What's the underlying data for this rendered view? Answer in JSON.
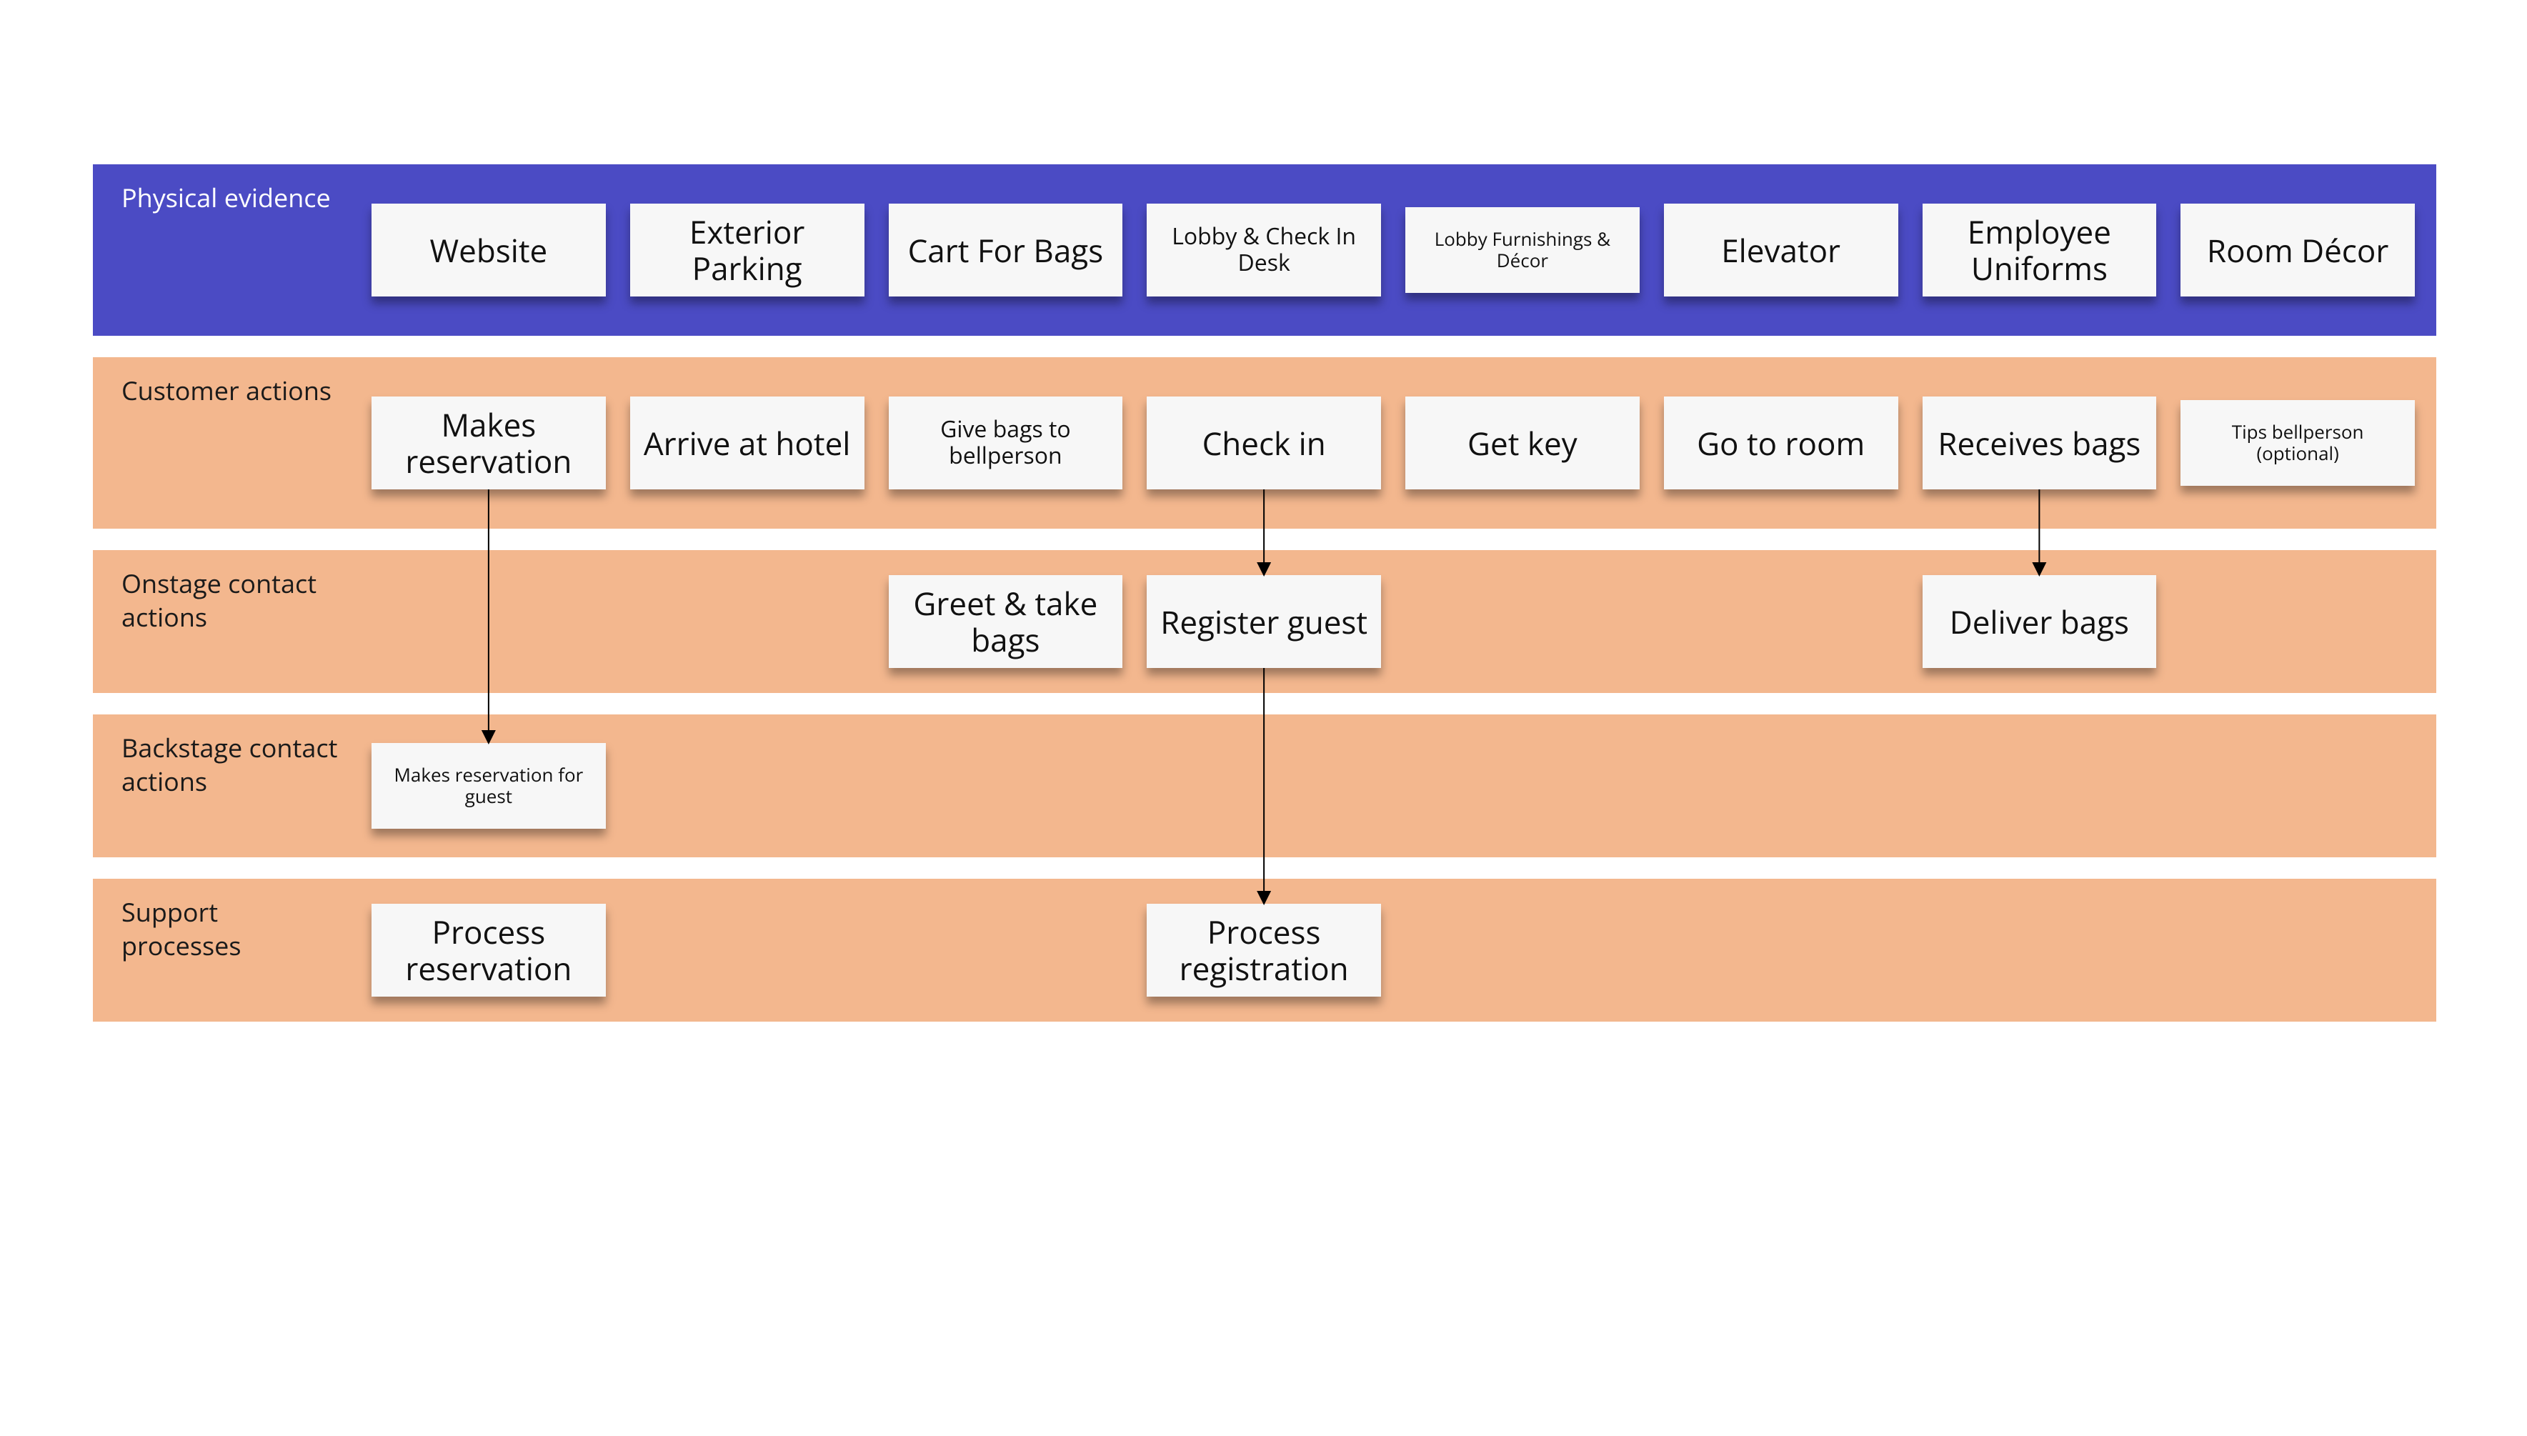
{
  "lanes": [
    {
      "id": "physical-evidence",
      "label": "Physical evidence",
      "bg": "purple",
      "labelLight": true,
      "cards": [
        {
          "text": "Website"
        },
        {
          "text": "Exterior Parking"
        },
        {
          "text": "Cart For Bags"
        },
        {
          "text": "Lobby & Check In Desk",
          "size": "sm"
        },
        {
          "text": "Lobby Furnishings & Décor",
          "size": "xs"
        },
        {
          "text": "Elevator"
        },
        {
          "text": "Employee Uniforms"
        },
        {
          "text": "Room Décor"
        }
      ]
    },
    {
      "id": "customer-actions",
      "label": "Customer actions",
      "bg": "peach",
      "cards": [
        {
          "text": "Makes reservation"
        },
        {
          "text": "Arrive at hotel"
        },
        {
          "text": "Give bags to bellperson",
          "size": "sm"
        },
        {
          "text": "Check in"
        },
        {
          "text": "Get key"
        },
        {
          "text": "Go to room"
        },
        {
          "text": "Receives bags"
        },
        {
          "text": "Tips bellperson (optional)",
          "size": "xs"
        }
      ]
    },
    {
      "id": "onstage-contact",
      "label": "Onstage contact actions",
      "bg": "peach",
      "cards": [
        {
          "empty": true
        },
        {
          "empty": true
        },
        {
          "text": "Greet & take bags"
        },
        {
          "text": "Register guest"
        },
        {
          "empty": true
        },
        {
          "empty": true
        },
        {
          "text": "Deliver bags"
        },
        {
          "empty": true
        }
      ]
    },
    {
      "id": "backstage-contact",
      "label": "Backstage contact actions",
      "bg": "peach",
      "cards": [
        {
          "text": "Makes reservation for guest",
          "size": "xs"
        },
        {
          "empty": true
        },
        {
          "empty": true
        },
        {
          "empty": true
        },
        {
          "empty": true
        },
        {
          "empty": true
        },
        {
          "empty": true
        },
        {
          "empty": true
        }
      ]
    },
    {
      "id": "support-processes",
      "label": "Support processes",
      "bg": "peach",
      "cards": [
        {
          "text": "Process reservation"
        },
        {
          "empty": true
        },
        {
          "empty": true
        },
        {
          "text": "Process registration"
        },
        {
          "empty": true
        },
        {
          "empty": true
        },
        {
          "empty": true
        },
        {
          "empty": true
        }
      ]
    }
  ],
  "connectors": [
    {
      "from": "customer-actions:0",
      "to": "backstage-contact:0"
    },
    {
      "from": "customer-actions:3",
      "to": "onstage-contact:3"
    },
    {
      "from": "onstage-contact:3",
      "to": "support-processes:3"
    },
    {
      "from": "customer-actions:6",
      "to": "onstage-contact:6"
    }
  ],
  "colors": {
    "purple": "#4b4bc4",
    "peach": "#f3b78e",
    "card": "#f7f7f7"
  }
}
